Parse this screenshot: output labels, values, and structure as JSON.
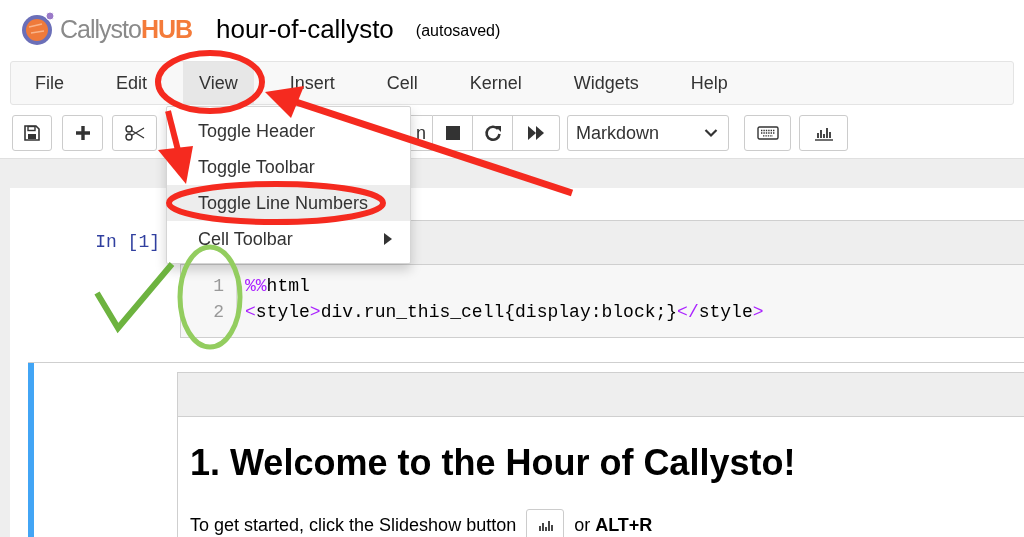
{
  "header": {
    "logo": {
      "name": "Callysto",
      "suffix": "HUB"
    },
    "title": "hour-of-callysto",
    "status": "(autosaved)"
  },
  "menu": [
    {
      "label": "File",
      "selected": false
    },
    {
      "label": "Edit",
      "selected": false
    },
    {
      "label": "View",
      "selected": true
    },
    {
      "label": "Insert",
      "selected": false
    },
    {
      "label": "Cell",
      "selected": false
    },
    {
      "label": "Kernel",
      "selected": false
    },
    {
      "label": "Widgets",
      "selected": false
    },
    {
      "label": "Help",
      "selected": false
    }
  ],
  "toolbar": [
    {
      "kind": "save"
    },
    {
      "kind": "add"
    },
    {
      "kind": "cut"
    },
    {
      "kind": "run",
      "label": "n"
    },
    {
      "kind": "stop"
    },
    {
      "kind": "restart"
    },
    {
      "kind": "run-all"
    },
    {
      "kind": "cell-type",
      "value": "Markdown"
    },
    {
      "kind": "keyboard"
    },
    {
      "kind": "slideshow"
    }
  ],
  "view_menu": {
    "items": [
      {
        "label": "Toggle Header",
        "selected": false,
        "submenu": false
      },
      {
        "label": "Toggle Toolbar",
        "selected": false,
        "submenu": false
      },
      {
        "label": "Toggle Line Numbers",
        "selected": true,
        "submenu": false
      },
      {
        "label": "Cell Toolbar",
        "selected": false,
        "submenu": true
      }
    ]
  },
  "code_cell": {
    "prompt": "In [1]",
    "selected": false,
    "lines": [
      {
        "number": "1",
        "tokens": [
          {
            "text": "%%",
            "kind": "keyword"
          },
          {
            "text": "html",
            "kind": "plain"
          }
        ]
      },
      {
        "number": "2",
        "tokens": [
          {
            "text": "<",
            "kind": "keyword"
          },
          {
            "text": "style",
            "kind": "plain"
          },
          {
            "text": ">",
            "kind": "keyword"
          },
          {
            "text": "div.run_this_cell{display:block;}",
            "kind": "plain"
          },
          {
            "text": "</",
            "kind": "keyword"
          },
          {
            "text": "style",
            "kind": "plain"
          },
          {
            "text": ">",
            "kind": "keyword"
          }
        ]
      }
    ]
  },
  "markdown_cell": {
    "selected": true,
    "heading": "1. Welcome to the Hour of Callysto!",
    "text_before": "To get started, click the Slideshow button",
    "text_after": "or **ALT+R**"
  }
}
